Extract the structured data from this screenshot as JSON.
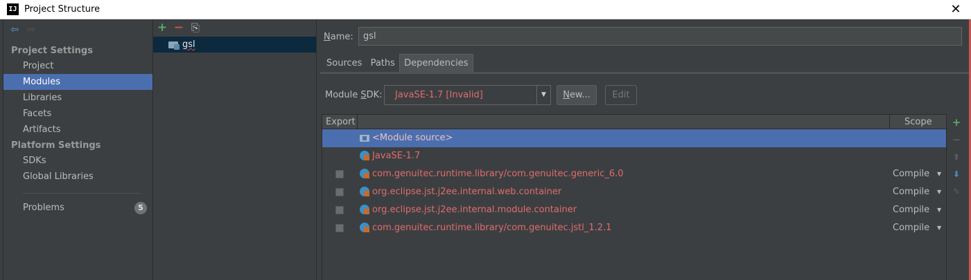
{
  "window": {
    "title": "Project Structure",
    "app_icon_text": "IJ",
    "close_glyph": "✕"
  },
  "nav": {
    "back_glyph": "⇦",
    "forward_glyph": "⇨",
    "project_settings_header": "Project Settings",
    "project_items": [
      "Project",
      "Modules",
      "Libraries",
      "Facets",
      "Artifacts"
    ],
    "platform_settings_header": "Platform Settings",
    "platform_items": [
      "SDKs",
      "Global Libraries"
    ],
    "problems_label": "Problems",
    "problems_count": "5",
    "selected_item": "Modules"
  },
  "tree": {
    "add_glyph": "+",
    "remove_glyph": "−",
    "copy_glyph": "⎘",
    "module_name": "gsl"
  },
  "module": {
    "name_label_prefix": "N",
    "name_label_rest": "ame:",
    "name_value": "gsl",
    "tabs": [
      "Sources",
      "Paths",
      "Dependencies"
    ],
    "active_tab": "Dependencies",
    "sdk_label_prefix": "Module ",
    "sdk_label_u": "S",
    "sdk_label_rest": "DK:",
    "sdk_value": "JavaSE-1.7 [Invalid]",
    "dropdown_glyph": "▼",
    "new_label_u": "N",
    "new_label_rest": "ew...",
    "edit_label": "Edit"
  },
  "dependencies": {
    "col_export": "Export",
    "col_scope": "Scope",
    "rows": [
      {
        "name": "<Module source>",
        "scope": ""
      },
      {
        "name": "JavaSE-1.7",
        "scope": ""
      },
      {
        "name": "com.genuitec.runtime.library/com.genuitec.generic_6.0",
        "scope": "Compile"
      },
      {
        "name": "org.eclipse.jst.j2ee.internal.web.container",
        "scope": "Compile"
      },
      {
        "name": "org.eclipse.jst.j2ee.internal.module.container",
        "scope": "Compile"
      },
      {
        "name": "com.genuitec.runtime.library/com.genuitec.jstl_1.2.1",
        "scope": "Compile"
      }
    ],
    "scope_dropdown_glyph": "▼",
    "tools": {
      "add": "+",
      "remove": "−",
      "up": "⬆",
      "down": "⬇",
      "edit": "✎"
    }
  },
  "colors": {
    "accent": "#4b6eaf",
    "error_text": "#e06c6c",
    "add_green": "#59a869",
    "remove_red": "#c75450"
  }
}
